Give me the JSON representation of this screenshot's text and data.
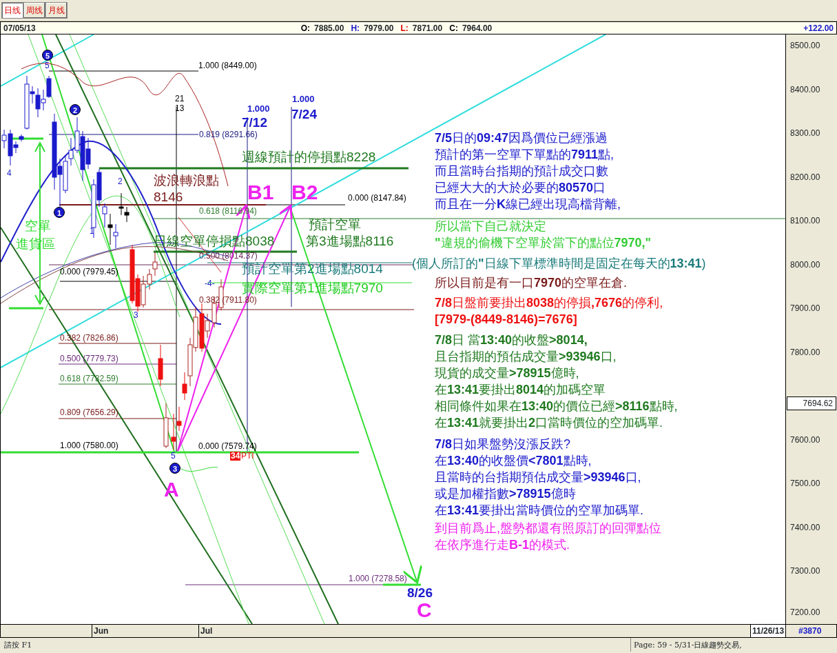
{
  "tabs": [
    {
      "label": "日线",
      "selected": true
    },
    {
      "label": "周线",
      "selected": false
    },
    {
      "label": "月线",
      "selected": false
    }
  ],
  "header": {
    "date": "07/05/13",
    "quotes": [
      {
        "kind": "open",
        "label": "O:",
        "value": "7885.00"
      },
      {
        "kind": "high",
        "label": "H:",
        "value": "7979.00"
      },
      {
        "kind": "low",
        "label": "L:",
        "value": "7871.00"
      },
      {
        "kind": "close",
        "label": "C:",
        "value": "7964.00"
      }
    ],
    "change": "+122.00"
  },
  "chart": {
    "price_axis": [
      "8500.00",
      "8400.00",
      "8300.00",
      "8200.00",
      "8100.00",
      "8000.00",
      "7900.00",
      "7800.00",
      "7600.00",
      "7500.00",
      "7400.00",
      "7300.00",
      "7200.00"
    ],
    "last_price": "7694.62",
    "annotations": [
      {
        "kind": "circle",
        "text": "5",
        "color": "#1a1acc"
      },
      {
        "kind": "wave",
        "text": "5",
        "color": "#1a1acc"
      },
      {
        "kind": "fib",
        "text": "1.000 (8449.00)",
        "color": "#000000"
      },
      {
        "kind": "small",
        "text": "21",
        "color": "#000000"
      },
      {
        "kind": "ratio",
        "text": "1.000",
        "color": "#1a1acc"
      },
      {
        "kind": "circle",
        "text": "2",
        "color": "#1a1acc"
      },
      {
        "kind": "small",
        "text": "13",
        "color": "#000000"
      },
      {
        "kind": "ratio",
        "text": "1.000",
        "color": "#1a1acc"
      },
      {
        "kind": "date",
        "text": "7/12",
        "color": "#1a1acc"
      },
      {
        "kind": "date",
        "text": "7/24",
        "color": "#1a1acc"
      },
      {
        "kind": "fib",
        "text": "0.819 (8291.66)",
        "color": "#1a1a80"
      },
      {
        "kind": "note",
        "text": "週線預計的停損點8228",
        "color": "#1f7a1f"
      },
      {
        "kind": "wave",
        "text": "4",
        "color": "#1a1acc"
      },
      {
        "kind": "wave",
        "text": "2",
        "color": "#1a1acc"
      },
      {
        "kind": "note",
        "text": "波浪轉浪點",
        "color": "#7a1a1a"
      },
      {
        "kind": "note",
        "text": "8146",
        "color": "#7a1a1a"
      },
      {
        "kind": "point",
        "text": "B1",
        "color": "#ee22ee"
      },
      {
        "kind": "point",
        "text": "B2",
        "color": "#ee22ee"
      },
      {
        "kind": "fib",
        "text": "0.000 (8147.84)",
        "color": "#000000"
      },
      {
        "kind": "circle",
        "text": "1",
        "color": "#1a1acc"
      },
      {
        "kind": "fib",
        "text": "0.618 (8116.94)",
        "color": "#2e7d2e"
      },
      {
        "kind": "note",
        "text": "空單",
        "color": "#33dd33"
      },
      {
        "kind": "wave",
        "text": "1",
        "color": "#1a1acc"
      },
      {
        "kind": "note",
        "text": "預計空單",
        "color": "#1f7a1f"
      },
      {
        "kind": "note",
        "text": "進貨區",
        "color": "#33dd33"
      },
      {
        "kind": "note",
        "text": "日線空單停損點8038",
        "color": "#1f7a1f"
      },
      {
        "kind": "note",
        "text": "第3進場點8116",
        "color": "#1f7a1f"
      },
      {
        "kind": "fib",
        "text": "0.500 (8014.37)",
        "color": "#6b2a5a"
      },
      {
        "kind": "fib",
        "text": "0.000 (7979.45)",
        "color": "#000000"
      },
      {
        "kind": "note",
        "text": "預計空單第2進場點8014",
        "color": "#1a7a7a"
      },
      {
        "kind": "wave",
        "text": "-4-",
        "color": "#1a1acc"
      },
      {
        "kind": "note",
        "text": "實際空單第1進場點7970",
        "color": "#22cc22"
      },
      {
        "kind": "fib",
        "text": "0.382 (7911.80)",
        "color": "#7a1a1a"
      },
      {
        "kind": "wave",
        "text": "3",
        "color": "#1a1acc"
      },
      {
        "kind": "fib",
        "text": "0.382 (7826.86)",
        "color": "#7a1a1a"
      },
      {
        "kind": "fib",
        "text": "0.500 (7779.73)",
        "color": "#6b2a7a"
      },
      {
        "kind": "fib",
        "text": "0.618 (7732.59)",
        "color": "#2e7d2e"
      },
      {
        "kind": "fib",
        "text": "0.809 (7656.29)",
        "color": "#7a1a1a"
      },
      {
        "kind": "fib",
        "text": "1.000 (7580.00)",
        "color": "#000000"
      },
      {
        "kind": "fib",
        "text": "0.000 (7579.74)",
        "color": "#000000"
      },
      {
        "kind": "wave",
        "text": "5",
        "color": "#1a1acc"
      },
      {
        "kind": "tag",
        "text": "34",
        "color": "#ee1111"
      },
      {
        "kind": "small",
        "text": "PTI",
        "color": "#ee1111"
      },
      {
        "kind": "circle",
        "text": "3",
        "color": "#1a1acc"
      },
      {
        "kind": "point",
        "text": "A",
        "color": "#ee22ee"
      },
      {
        "kind": "fib",
        "text": "1.000 (7278.58)",
        "color": "#6b2a7a"
      },
      {
        "kind": "date",
        "text": "8/26",
        "color": "#1a1acc"
      },
      {
        "kind": "point",
        "text": "C",
        "color": "#ee22ee"
      }
    ],
    "notes": [
      {
        "color": "#1a1acc",
        "lines": [
          "**7/5**日的**09:47**因爲價位已經漲過",
          "預計的第一空單下單點的**7911**點,",
          "而且當時台指期的預計成交口數",
          "已經大大的大於必要的**80570**口",
          "而且在一分**K**線已經出現高檔背離,"
        ]
      },
      {
        "color": "#33cc33",
        "lines": [
          "所以當下自己就決定",
          "**\"**違規的偷機下空單於當下的點位**7970,\"**"
        ]
      },
      {
        "color": "#1a7a7a",
        "lines": [
          "(個人所訂的**\"**日線下單標準時間是固定在每天的**13:41**)"
        ]
      },
      {
        "color": "#7a1a1a",
        "lines": [
          "所以目前是有一口**7970**的空單在倉."
        ]
      },
      {
        "color": "#ee1111",
        "lines": [
          "**7/8**日盤前要掛出**8038**的停損**,7676**的停利,",
          "**[7979-(8449-8146)=7676]**"
        ]
      },
      {
        "color": "#1f7a1f",
        "lines": [
          "**7/8**日 當**13:40**的收盤**>8014,**",
          "且台指期的預估成交量**>93946**口,",
          "現貨的成交量**>78915**億時,",
          "在**13:41**要掛出**8014**的加碼空單",
          "相同條件如果在**13:40**的價位已經**>8116**點時,",
          "在**13:41**就要掛出**2**口當時價位的空加碼單."
        ]
      },
      {
        "color": "#1a1acc",
        "lines": [
          "**7/8**日如果盤勢沒漲反跌?",
          "在**13:40**的收盤價**<7801**點時,",
          "且當時的台指期預估成交量**>93946**口,",
          "或是加權指數**>78915**億時",
          "在**13:41**要掛出當時價位的空單加碼單."
        ]
      },
      {
        "color": "#ee22ee",
        "lines": [
          "到目前爲止,盤勢都還有照原訂的回彈點位",
          "在依序進行走**B-1**的模式."
        ]
      }
    ]
  },
  "time_axis": {
    "months": [
      "Jun",
      "Jul"
    ],
    "cursor_date": "11/26/13",
    "bar_count": "#3870"
  },
  "status_bar": {
    "hint": "請按 F1",
    "page": "Page: 59 - 5/31-日線趨勢交易,"
  }
}
